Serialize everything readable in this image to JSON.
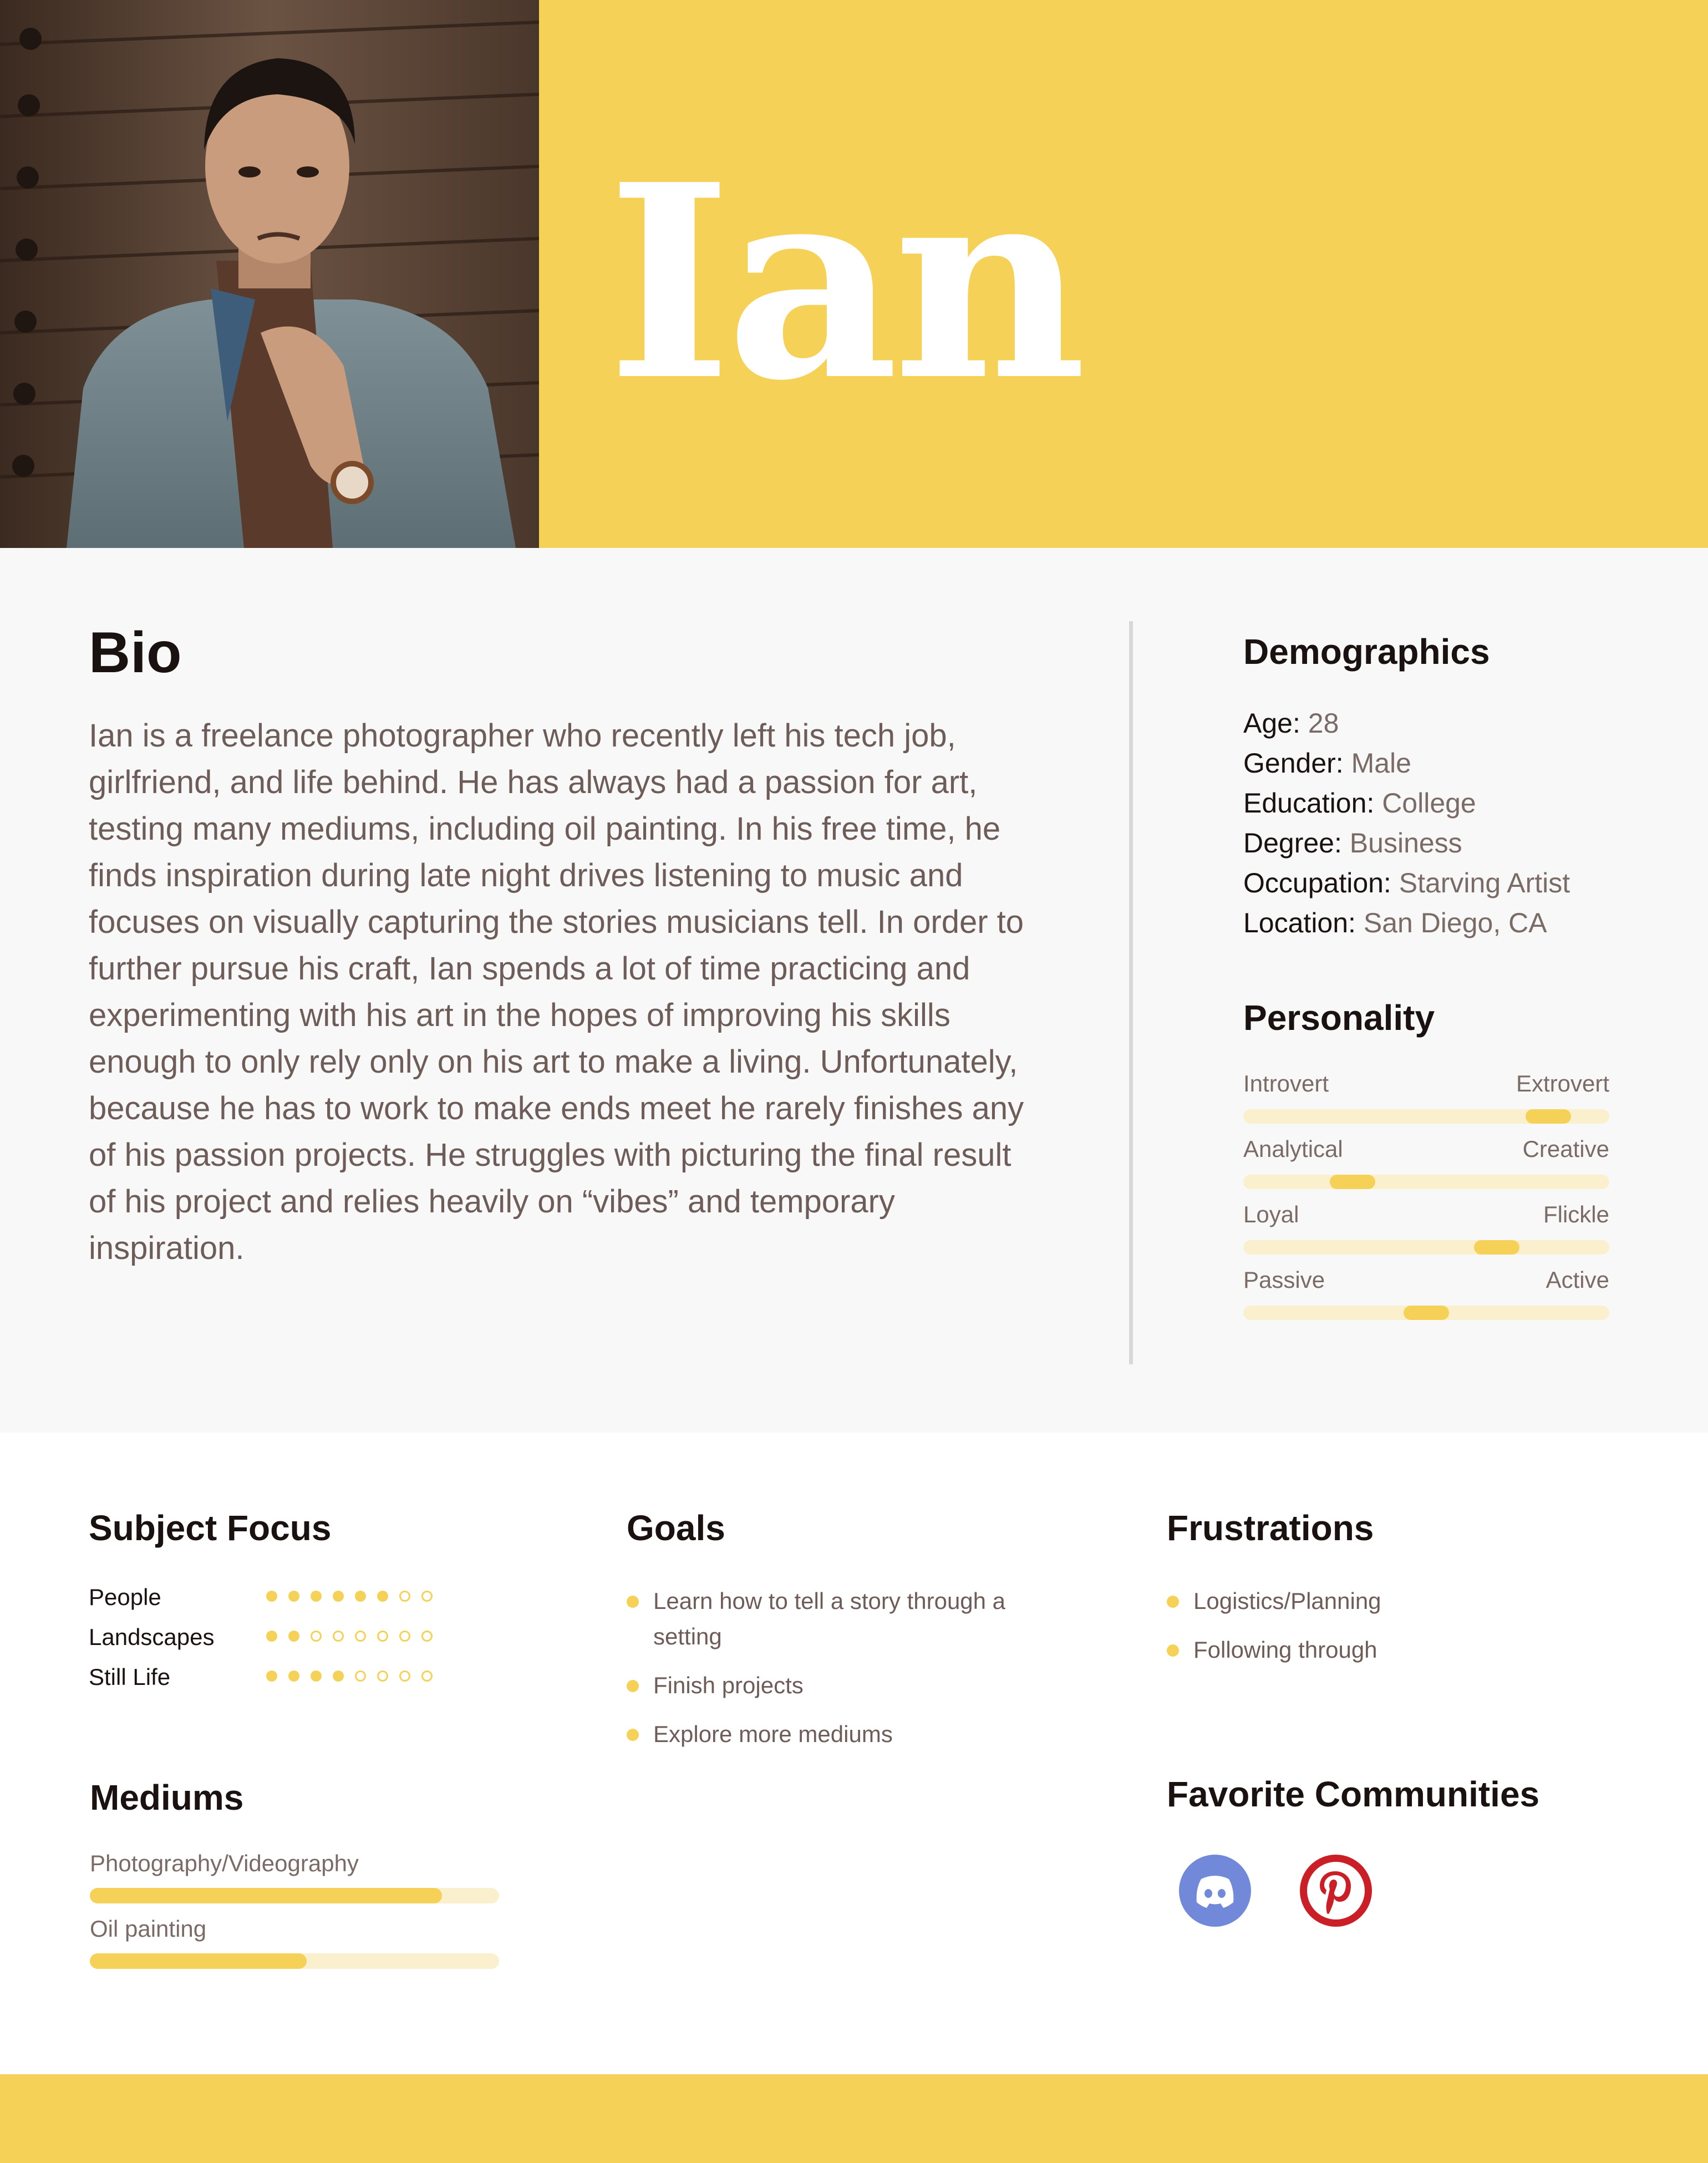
{
  "persona": {
    "name": "Ian"
  },
  "bio": {
    "title": "Bio",
    "text": "Ian is a freelance photographer who recently left his tech job, girlfriend, and life behind. He has always had a passion for art, testing many mediums, including oil painting. In his free time, he finds inspiration during late night drives listening to music and focuses on visually capturing the stories musicians tell. In order to further pursue his craft, Ian spends a lot of time practicing and experimenting with his art in the hopes of improving his skills enough to only rely only on his art to make a living. Unfortunately, because he has to work to make ends meet he rarely finishes any of his passion projects. He struggles with picturing the final result of his project and relies heavily on “vibes” and temporary inspiration."
  },
  "demographics": {
    "title": "Demographics",
    "rows": [
      {
        "label": "Age:",
        "value": "28"
      },
      {
        "label": "Gender:",
        "value": "Male"
      },
      {
        "label": "Education:",
        "value": "College"
      },
      {
        "label": "Degree:",
        "value": "Business"
      },
      {
        "label": "Occupation:",
        "value": "Starving Artist"
      },
      {
        "label": "Location:",
        "value": "San Diego, CA"
      }
    ]
  },
  "personality": {
    "title": "Personality",
    "traits": [
      {
        "left": "Introvert",
        "right": "Extrovert",
        "level": 0.88
      },
      {
        "left": "Analytical",
        "right": "Creative",
        "level": 0.27
      },
      {
        "left": "Loyal",
        "right": "Flickle",
        "level": 0.72
      },
      {
        "left": "Passive",
        "right": "Active",
        "level": 0.5
      }
    ]
  },
  "subject_focus": {
    "title": "Subject Focus",
    "max": 8,
    "items": [
      {
        "label": "People",
        "rating": 6
      },
      {
        "label": "Landscapes",
        "rating": 2
      },
      {
        "label": "Still Life",
        "rating": 4
      }
    ]
  },
  "goals": {
    "title": "Goals",
    "items": [
      "Learn how to tell a story through a setting",
      "Finish projects",
      "Explore more mediums"
    ]
  },
  "frustrations": {
    "title": "Frustrations",
    "items": [
      "Logistics/Planning",
      "Following through"
    ]
  },
  "mediums": {
    "title": "Mediums",
    "items": [
      {
        "label": "Photography/Videography",
        "level": 0.86
      },
      {
        "label": "Oil painting",
        "level": 0.53
      }
    ]
  },
  "favorite_communities": {
    "title": "Favorite Communities",
    "icons": [
      {
        "name": "discord-icon",
        "color": "#7289da"
      },
      {
        "name": "pinterest-icon",
        "color": "#cb1f27"
      }
    ]
  },
  "colors": {
    "accent": "#f5d257",
    "accent_light": "#faf0cd",
    "body_text": "#6d5c57",
    "heading": "#1a1210",
    "panel_bg": "#f8f8f8"
  }
}
